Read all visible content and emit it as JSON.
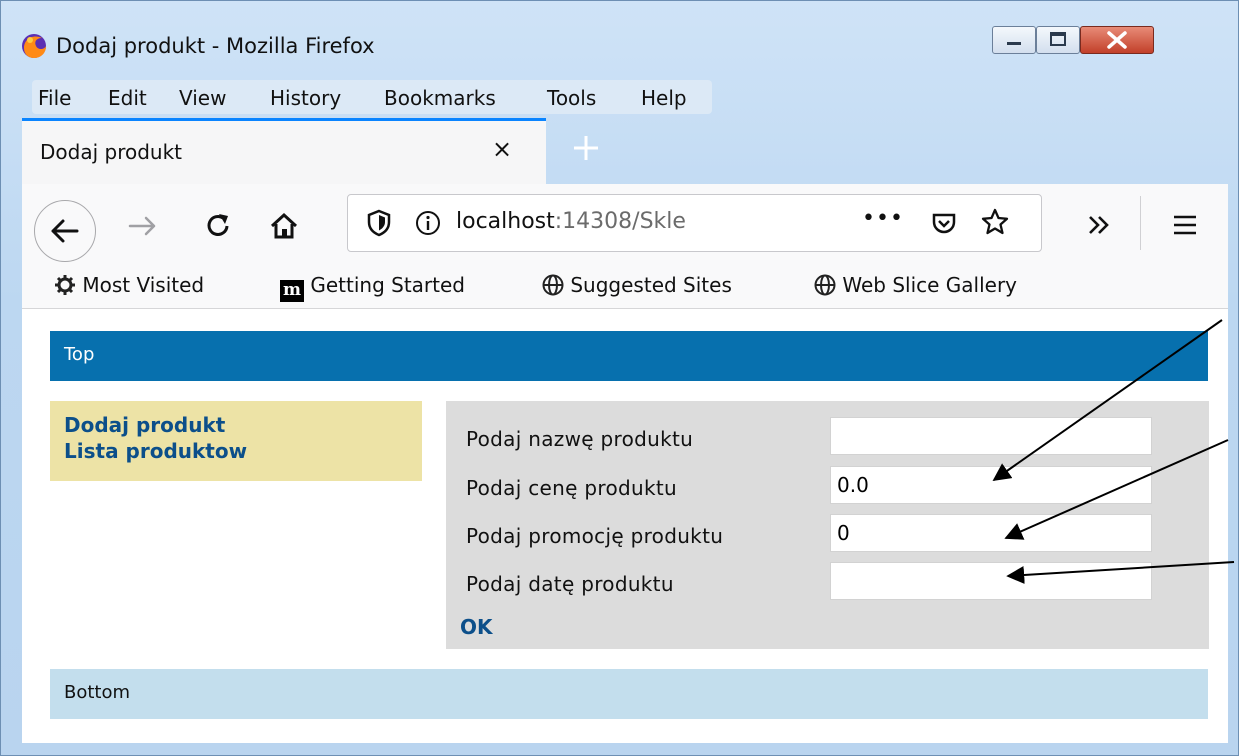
{
  "window": {
    "title": "Dodaj produkt - Mozilla Firefox",
    "buttons": {
      "minimize": "minimize-icon",
      "maximize": "maximize-icon",
      "close": "close-icon"
    }
  },
  "menu": {
    "items": [
      {
        "label": "File"
      },
      {
        "label": "Edit"
      },
      {
        "label": "View"
      },
      {
        "label": "History"
      },
      {
        "label": "Bookmarks"
      },
      {
        "label": "Tools"
      },
      {
        "label": "Help"
      }
    ]
  },
  "tabs": {
    "active": {
      "title": "Dodaj produkt",
      "close": "×"
    },
    "new_tab": "+"
  },
  "navbar": {
    "url_host": "localhost",
    "url_rest": ":14308/Skle",
    "page_actions": "•••"
  },
  "bookmarks": {
    "items": [
      {
        "label": "Most Visited",
        "icon": "gear-icon"
      },
      {
        "label": "Getting Started",
        "icon": "m-logo-icon"
      },
      {
        "label": "Suggested Sites",
        "icon": "globe-icon"
      },
      {
        "label": "Web Slice Gallery",
        "icon": "globe-icon"
      }
    ]
  },
  "page": {
    "top": "Top",
    "bottom": "Bottom",
    "sidebar": {
      "links": [
        {
          "label": "Dodaj produkt"
        },
        {
          "label": "Lista produktow"
        }
      ]
    },
    "form": {
      "fields": [
        {
          "label": "Podaj nazwę produktu",
          "value": ""
        },
        {
          "label": "Podaj cenę produktu",
          "value": "0.0"
        },
        {
          "label": "Podaj promocję produktu",
          "value": "0"
        },
        {
          "label": "Podaj datę produktu",
          "value": ""
        }
      ],
      "submit": "OK"
    }
  },
  "colors": {
    "top_bar": "#0770ae",
    "sidebar": "#ede3a6",
    "form_panel": "#dcdcdc",
    "bottom_bar": "#c3deed",
    "link": "#0c4f8a",
    "tab_accent": "#0a84ff"
  }
}
